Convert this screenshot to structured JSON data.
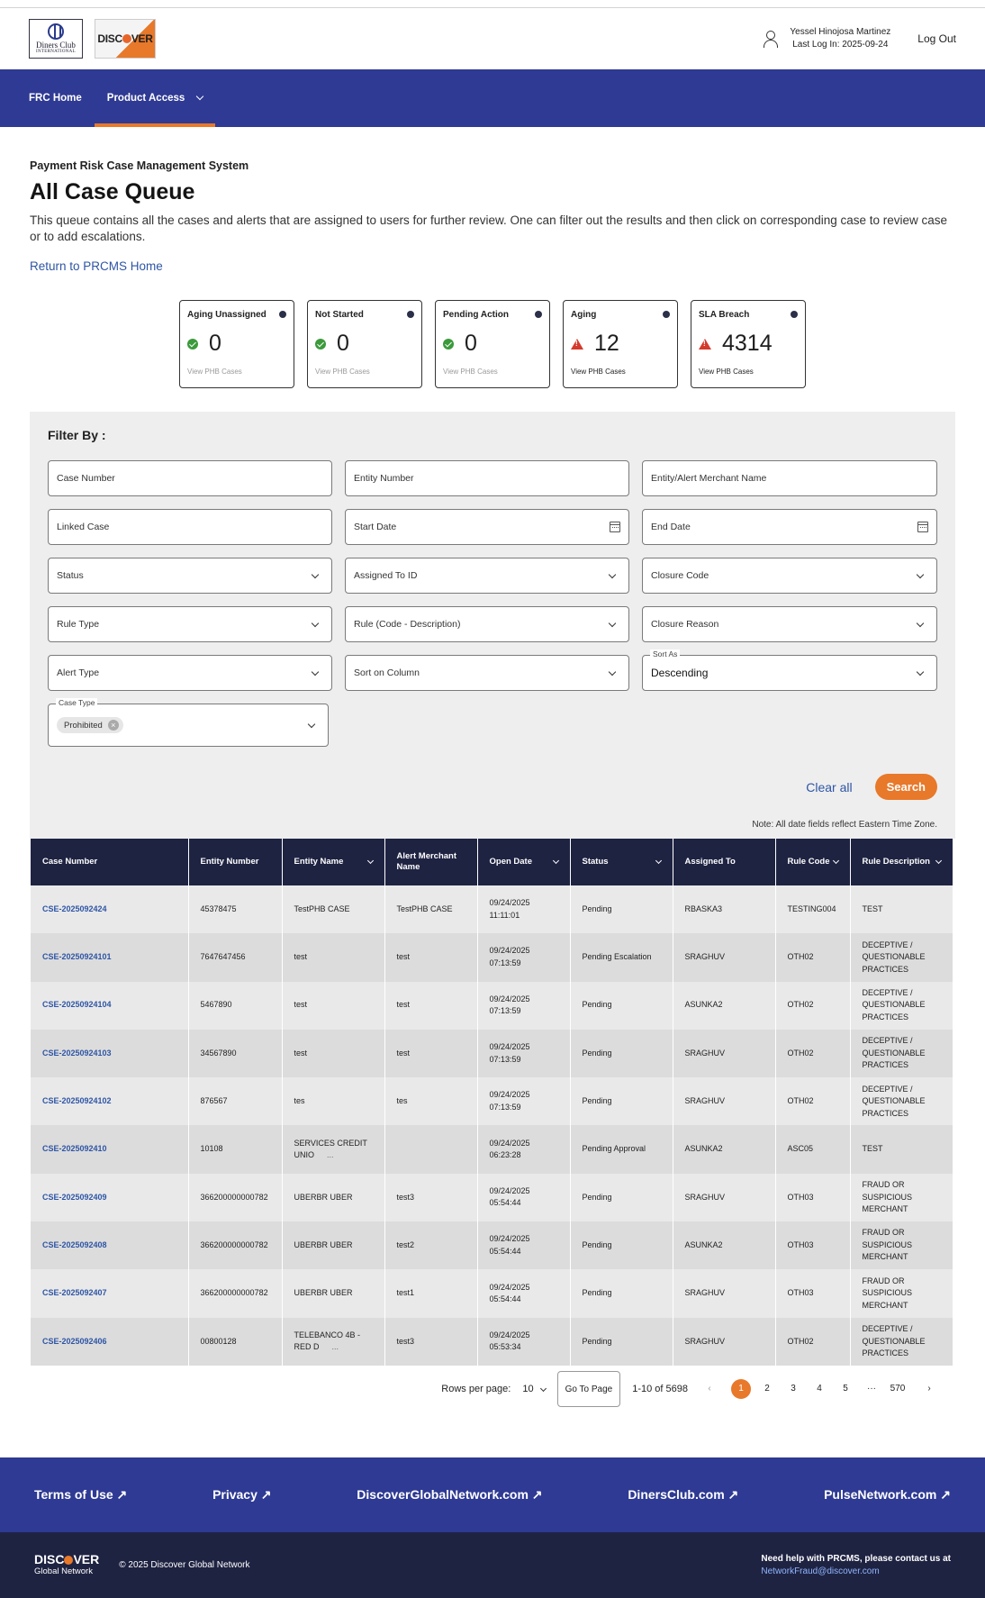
{
  "header": {
    "logo_diners_text": "Diners Club",
    "logo_diners_sub": "INTERNATIONAL",
    "logo_discover": "DISC",
    "logo_discover_end": "VER",
    "user_name": "Yessel Hinojosa Martinez",
    "last_login": "Last Log In: 2025-09-24",
    "logout": "Log Out"
  },
  "nav": {
    "home": "FRC Home",
    "product_access": "Product Access"
  },
  "page": {
    "eyebrow": "Payment Risk Case Management System",
    "title": "All Case Queue",
    "description": "This queue contains all the cases and alerts that are assigned to users for further review. One can filter out the results and then click on corresponding case to review case or to add escalations.",
    "return_link": "Return to PRCMS Home"
  },
  "cards": [
    {
      "title": "Aging Unassigned",
      "value": "0",
      "status": "ok",
      "link": "View PHB Cases",
      "link_active": false
    },
    {
      "title": "Not Started",
      "value": "0",
      "status": "ok",
      "link": "View PHB Cases",
      "link_active": false
    },
    {
      "title": "Pending Action",
      "value": "0",
      "status": "ok",
      "link": "View PHB Cases",
      "link_active": false
    },
    {
      "title": "Aging",
      "value": "12",
      "status": "warn",
      "link": "View PHB Cases",
      "link_active": true
    },
    {
      "title": "SLA Breach",
      "value": "4314",
      "status": "warn",
      "link": "View PHB Cases",
      "link_active": true
    }
  ],
  "filter": {
    "title": "Filter By :",
    "case_number": "Case Number",
    "entity_number": "Entity Number",
    "merchant_name": "Entity/Alert Merchant Name",
    "linked_case": "Linked Case",
    "start_date": "Start Date",
    "end_date": "End Date",
    "status": "Status",
    "assigned_to": "Assigned To ID",
    "closure_code": "Closure Code",
    "rule_type": "Rule Type",
    "rule": "Rule (Code - Description)",
    "closure_reason": "Closure Reason",
    "alert_type": "Alert Type",
    "sort_column": "Sort on Column",
    "sort_as_label": "Sort As",
    "sort_as_value": "Descending",
    "case_type_label": "Case Type",
    "case_type_chip": "Prohibited",
    "clear": "Clear all",
    "search": "Search",
    "note": "Note: All date fields reflect Eastern Time Zone."
  },
  "table": {
    "headers": [
      "Case Number",
      "Entity Number",
      "Entity Name",
      "Alert Merchant Name",
      "Open Date",
      "Status",
      "Assigned To",
      "Rule Code",
      "Rule Description"
    ],
    "rows": [
      [
        "CSE-2025092424",
        "45378475",
        "TestPHB CASE",
        "TestPHB CASE",
        "09/24/2025 11:11:01",
        "Pending",
        "RBASKA3",
        "TESTING004",
        "TEST"
      ],
      [
        "CSE-20250924101",
        "7647647456",
        "test",
        "test",
        "09/24/2025 07:13:59",
        "Pending Escalation",
        "SRAGHUV",
        "OTH02",
        "DECEPTIVE / QUESTIONABLE PRACTICES"
      ],
      [
        "CSE-20250924104",
        "5467890",
        "test",
        "test",
        "09/24/2025 07:13:59",
        "Pending",
        "ASUNKA2",
        "OTH02",
        "DECEPTIVE / QUESTIONABLE PRACTICES"
      ],
      [
        "CSE-20250924103",
        "34567890",
        "test",
        "test",
        "09/24/2025 07:13:59",
        "Pending",
        "SRAGHUV",
        "OTH02",
        "DECEPTIVE / QUESTIONABLE PRACTICES"
      ],
      [
        "CSE-20250924102",
        "876567",
        "tes",
        "tes",
        "09/24/2025 07:13:59",
        "Pending",
        "SRAGHUV",
        "OTH02",
        "DECEPTIVE / QUESTIONABLE PRACTICES"
      ],
      [
        "CSE-2025092410",
        "10108",
        "SERVICES CREDIT UNIO",
        "",
        "09/24/2025 06:23:28",
        "Pending Approval",
        "ASUNKA2",
        "ASC05",
        "TEST"
      ],
      [
        "CSE-2025092409",
        "366200000000782",
        "UBERBR UBER",
        "test3",
        "09/24/2025 05:54:44",
        "Pending",
        "SRAGHUV",
        "OTH03",
        "FRAUD OR SUSPICIOUS MERCHANT"
      ],
      [
        "CSE-2025092408",
        "366200000000782",
        "UBERBR UBER",
        "test2",
        "09/24/2025 05:54:44",
        "Pending",
        "ASUNKA2",
        "OTH03",
        "FRAUD OR SUSPICIOUS MERCHANT"
      ],
      [
        "CSE-2025092407",
        "366200000000782",
        "UBERBR UBER",
        "test1",
        "09/24/2025 05:54:44",
        "Pending",
        "SRAGHUV",
        "OTH03",
        "FRAUD OR SUSPICIOUS MERCHANT"
      ],
      [
        "CSE-2025092406",
        "00800128",
        "TELEBANCO 4B - RED D",
        "test3",
        "09/24/2025 05:53:34",
        "Pending",
        "SRAGHUV",
        "OTH02",
        "DECEPTIVE / QUESTIONABLE PRACTICES"
      ]
    ],
    "truncated_rows": [
      5,
      9
    ]
  },
  "pager": {
    "rows_label": "Rows per page:",
    "rows_value": "10",
    "go": "Go To Page",
    "range": "1-10 of 5698",
    "prev": "‹",
    "next": "›",
    "pages": [
      "1",
      "2",
      "3",
      "4",
      "5",
      "···",
      "570"
    ],
    "current": "1"
  },
  "footer": {
    "links": [
      "Terms of Use ↗",
      "Privacy ↗",
      "DiscoverGlobalNetwork.com ↗",
      "DinersClub.com ↗",
      "PulseNetwork.com ↗"
    ],
    "logo_a": "DISC",
    "logo_b": "VER",
    "logo_sub": "Global Network",
    "copyright": "© 2025 Discover Global Network",
    "help": "Need help with PRCMS, please contact us at",
    "email": "NetworkFraud@discover.com"
  },
  "colors": {
    "nav": "#2e3a93",
    "accent": "#e8782a",
    "table_header": "#1f2342",
    "link": "#2e55a5",
    "ok": "#3b9a3b",
    "warn": "#d53a2d"
  }
}
